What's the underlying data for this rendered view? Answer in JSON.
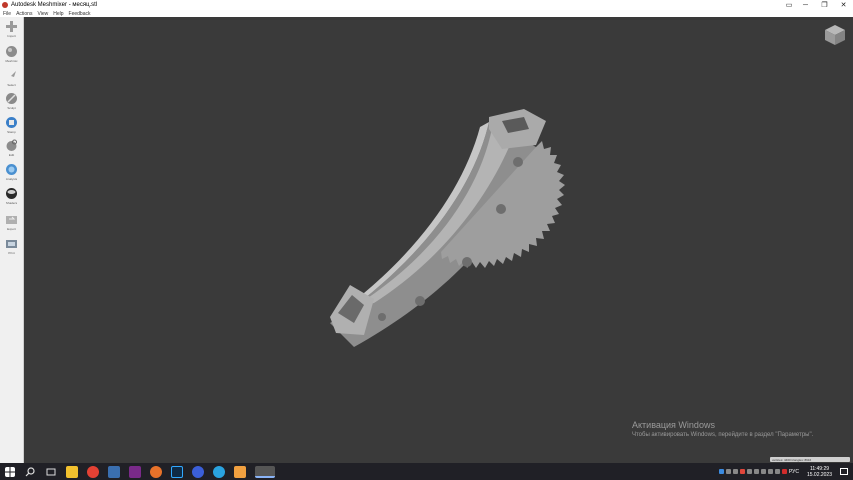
{
  "window": {
    "title": "Autodesk Meshmixer - месяц.stl",
    "controls": {
      "minimize": "─",
      "maximize": "❐",
      "close": "✕"
    }
  },
  "menu": [
    "File",
    "Actions",
    "View",
    "Help",
    "Feedback"
  ],
  "toolbar": [
    {
      "label": "Import",
      "icon": "plus-icon"
    },
    {
      "label": "Meshmix",
      "icon": "sphere-icon"
    },
    {
      "label": "Select",
      "icon": "arrow-icon"
    },
    {
      "label": "Sculpt",
      "icon": "brush-icon"
    },
    {
      "label": "Stamp",
      "icon": "stamp-icon"
    },
    {
      "label": "Edit",
      "icon": "edit-icon"
    },
    {
      "label": "Analysis",
      "icon": "analysis-icon"
    },
    {
      "label": "Shaders",
      "icon": "shader-icon"
    },
    {
      "label": "Export",
      "icon": "export-icon"
    },
    {
      "label": "Print",
      "icon": "print-icon"
    }
  ],
  "activation": {
    "title": "Активация Windows",
    "subtitle": "Чтобы активировать Windows, перейдите в раздел \"Параметры\"."
  },
  "status_pill": "vertices: 4460 triangles: 8916",
  "taskbar": {
    "apps": [
      {
        "name": "start",
        "color": "#ffffff"
      },
      {
        "name": "search",
        "color": "#dddddd"
      },
      {
        "name": "task-view",
        "color": "#dddddd"
      },
      {
        "name": "file-explorer",
        "color": "#f2c12e"
      },
      {
        "name": "chrome",
        "color": "#e44134"
      },
      {
        "name": "calculator",
        "color": "#3a6fb0"
      },
      {
        "name": "app-purple",
        "color": "#7a2a8a"
      },
      {
        "name": "firefox",
        "color": "#e8722a"
      },
      {
        "name": "photoshop",
        "color": "#0e2a45"
      },
      {
        "name": "app-blue-round",
        "color": "#3b5fd9"
      },
      {
        "name": "telegram",
        "color": "#2aa3e0"
      },
      {
        "name": "app-orange",
        "color": "#f0a040"
      },
      {
        "name": "meshmixer",
        "color": "#9a9a9a"
      }
    ],
    "language": "РУС",
    "time": "11:49:29",
    "date": "15.02.2023"
  },
  "colors": {
    "viewport": "#3a3a3a",
    "toolbar": "#f0f0f0",
    "taskbar": "#202026",
    "model": "#a8a8a8"
  }
}
